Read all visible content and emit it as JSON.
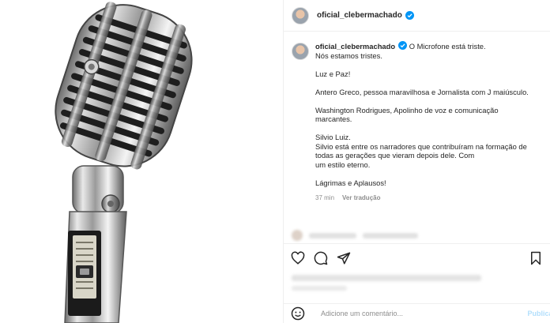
{
  "header": {
    "username": "oficial_clebermachado"
  },
  "caption": {
    "username": "oficial_clebermachado",
    "lines": [
      "O Microfone está triste.",
      "Nós estamos tristes.",
      "",
      "Luz e Paz!",
      "",
      "Antero Greco, pessoa maravilhosa e Jornalista com J maiúsculo.",
      "",
      "Washington Rodrigues, Apolinho de voz e comunicação",
      "marcantes.",
      "",
      "Silvio Luiz.",
      "Silvio está entre os narradores que contribuíram na formação de",
      "todas as gerações que vieram depois dele. Com",
      "um estilo eterno.",
      "",
      "Lágrimas e Aplausos!"
    ],
    "time": "37 min",
    "translate_label": "Ver tradução"
  },
  "comment_input": {
    "placeholder": "Adicione um comentário..."
  },
  "publish_label": "Publicar",
  "icons": [
    "verified-badge-icon",
    "heart-icon",
    "comment-icon",
    "share-icon",
    "bookmark-icon",
    "emoji-icon"
  ],
  "colors": {
    "verified": "#0095f6",
    "text": "#262626",
    "muted": "#8e8e8e",
    "publish_disabled": "#b2dffc"
  }
}
